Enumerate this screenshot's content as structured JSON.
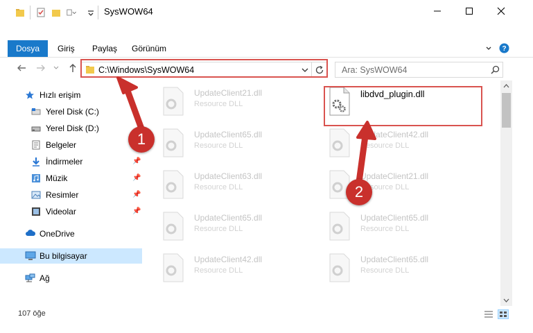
{
  "window": {
    "title": "SysWOW64",
    "minimize_icon": "minimize-icon",
    "maximize_icon": "maximize-icon",
    "close_icon": "close-icon"
  },
  "ribbon": {
    "tabs": [
      "Dosya",
      "Giriş",
      "Paylaş",
      "Görünüm"
    ],
    "active_tab": "Dosya",
    "accent": "#1979ca"
  },
  "address": {
    "path": "C:\\Windows\\SysWOW64"
  },
  "search": {
    "placeholder": "Ara: SysWOW64"
  },
  "sidebar": {
    "items": [
      {
        "label": "Hızlı erişim",
        "icon": "star-icon"
      },
      {
        "label": "Yerel Disk (C:)",
        "icon": "drive-icon"
      },
      {
        "label": "Yerel Disk (D:)",
        "icon": "drive-icon"
      },
      {
        "label": "Belgeler",
        "icon": "documents-icon"
      },
      {
        "label": "İndirmeler",
        "icon": "download-icon"
      },
      {
        "label": "Müzik",
        "icon": "music-icon"
      },
      {
        "label": "Resimler",
        "icon": "pictures-icon"
      },
      {
        "label": "Videolar",
        "icon": "video-icon"
      },
      {
        "label": "OneDrive",
        "icon": "cloud-icon"
      },
      {
        "label": "Bu bilgisayar",
        "icon": "computer-icon"
      },
      {
        "label": "Ağ",
        "icon": "network-icon"
      }
    ],
    "selected": "Bu bilgisayar",
    "selected_color": "#cce8ff"
  },
  "files": [
    {
      "name": "UpdateClient21.dll",
      "type": "Resource DLL"
    },
    {
      "name": "libdvd_plugin.dll",
      "type": ""
    },
    {
      "name": "UpdateClient65.dll",
      "type": "Resource DLL"
    },
    {
      "name": "UpdateClient42.dll",
      "type": "Resource DLL"
    },
    {
      "name": "UpdateClient63.dll",
      "type": "Resource DLL"
    },
    {
      "name": "UpdateClient21.dll",
      "type": "Resource DLL"
    },
    {
      "name": "UpdateClient65.dll",
      "type": "Resource DLL"
    },
    {
      "name": "UpdateClient65.dll",
      "type": "Resource DLL"
    },
    {
      "name": "UpdateClient42.dll",
      "type": "Resource DLL"
    },
    {
      "name": "UpdateClient65.dll",
      "type": "Resource DLL"
    }
  ],
  "status": {
    "count": "107 öğe"
  },
  "annotations": {
    "step1": "1",
    "step2": "2",
    "highlight_color": "#d9534f",
    "badge_color": "#c9302c"
  }
}
